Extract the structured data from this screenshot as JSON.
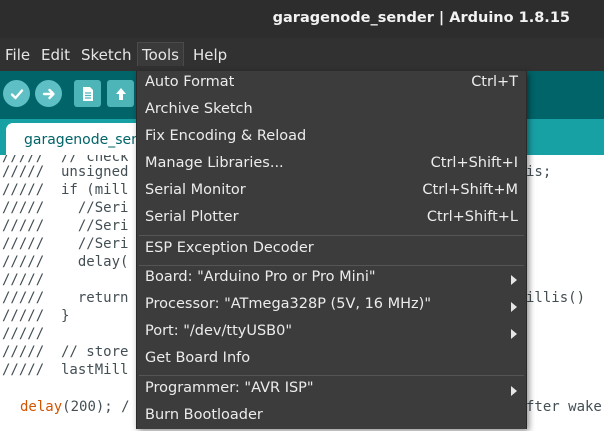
{
  "window": {
    "title": "garagenode_sender | Arduino 1.8.15"
  },
  "menubar": {
    "items": [
      {
        "label": "File"
      },
      {
        "label": "Edit"
      },
      {
        "label": "Sketch"
      },
      {
        "label": "Tools"
      },
      {
        "label": "Help"
      }
    ]
  },
  "toolbar": {
    "buttons": [
      {
        "icon": "verify-check-icon"
      },
      {
        "icon": "upload-arrow-icon"
      },
      {
        "icon": "new-file-icon"
      },
      {
        "icon": "open-arrow-icon"
      }
    ]
  },
  "tabs": [
    {
      "label": "garagenode_sen"
    }
  ],
  "editor": {
    "lines": [
      "/////  // check",
      "/////  unsigned",
      "/////  if (mill",
      "/////    //Seri",
      "/////    //Seri",
      "/////    //Seri",
      "/////    delay(",
      "/////",
      "/////    return",
      "/////  }",
      "/////",
      "/////  // store",
      "/////  lastMill"
    ],
    "last_line_keyword": "delay",
    "last_line_rest": "(200); /",
    "right_fragments": [
      "is;",
      "illis()",
      "fter wake"
    ]
  },
  "tools_menu": {
    "items": [
      {
        "label": "Auto Format",
        "shortcut": "Ctrl+T"
      },
      {
        "label": "Archive Sketch",
        "shortcut": ""
      },
      {
        "label": "Fix Encoding & Reload",
        "shortcut": ""
      },
      {
        "label": "Manage Libraries...",
        "shortcut": "Ctrl+Shift+I"
      },
      {
        "label": "Serial Monitor",
        "shortcut": "Ctrl+Shift+M"
      },
      {
        "label": "Serial Plotter",
        "shortcut": "Ctrl+Shift+L"
      },
      {
        "label": "ESP Exception Decoder",
        "shortcut": ""
      },
      {
        "label": "Board: \"Arduino Pro or Pro Mini\"",
        "shortcut": ""
      },
      {
        "label": "Processor: \"ATmega328P (5V, 16 MHz)\"",
        "shortcut": ""
      },
      {
        "label": "Port: \"/dev/ttyUSB0\"",
        "shortcut": ""
      },
      {
        "label": "Get Board Info",
        "shortcut": ""
      },
      {
        "label": "Programmer: \"AVR ISP\"",
        "shortcut": ""
      },
      {
        "label": "Burn Bootloader",
        "shortcut": ""
      }
    ]
  },
  "colors": {
    "title_bg": "#2d2d2d",
    "menubar_bg": "#313131",
    "toolbar_bg": "#006468",
    "tab_strip_bg": "#17a1a5",
    "menu_bg": "#3c3c3c",
    "keyword": "#d35400"
  }
}
